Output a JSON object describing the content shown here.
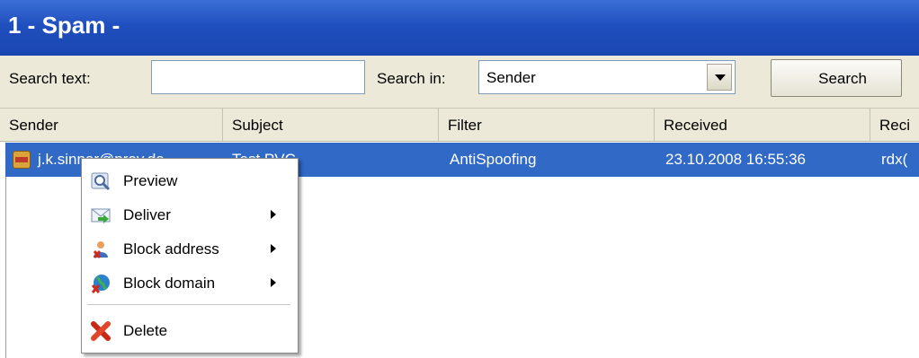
{
  "window": {
    "title": "1 - Spam -"
  },
  "search": {
    "text_label": "Search text:",
    "text_value": "",
    "in_label": "Search in:",
    "in_selected": "Sender",
    "button_label": "Search"
  },
  "columns": [
    "Sender",
    "Subject",
    "Filter",
    "Received",
    "Reci"
  ],
  "row": {
    "sender": "j.k.sinner@prov.de",
    "subject": "Test PVC",
    "filter": "AntiSpoofing",
    "received": "23.10.2008 16:55:36",
    "recipient": "rdx("
  },
  "context_menu": {
    "items": [
      {
        "label": "Preview",
        "icon": "preview-icon",
        "submenu": false
      },
      {
        "label": "Deliver",
        "icon": "deliver-icon",
        "submenu": true
      },
      {
        "label": "Block address",
        "icon": "block-address-icon",
        "submenu": true
      },
      {
        "label": "Block domain",
        "icon": "block-domain-icon",
        "submenu": true
      },
      {
        "label": "Delete",
        "icon": "delete-icon",
        "submenu": false
      }
    ]
  },
  "colors": {
    "title_bar": "#1f4fbe",
    "selection": "#3169c6",
    "toolbar": "#ece9d8"
  }
}
